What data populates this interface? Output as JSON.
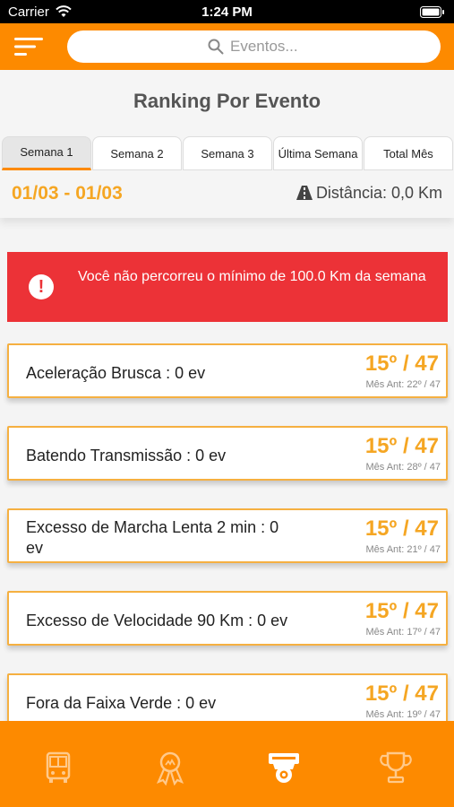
{
  "status_bar": {
    "carrier": "Carrier",
    "time": "1:24 PM",
    "wifi_icon": "wifi-icon",
    "battery_icon": "battery-icon"
  },
  "header": {
    "menu_icon": "hamburger-menu-icon",
    "search": {
      "placeholder": "Eventos...",
      "value": ""
    },
    "accent_color": "#fd8a00"
  },
  "page": {
    "title": "Ranking Por Evento",
    "tabs": [
      {
        "label": "Semana 1",
        "active": true
      },
      {
        "label": "Semana 2",
        "active": false
      },
      {
        "label": "Semana 3",
        "active": false
      },
      {
        "label": "Última Semana",
        "active": false
      },
      {
        "label": "Total Mês",
        "active": false
      }
    ],
    "date_range": "01/03 - 01/03",
    "distance": "Distância: 0,0 Km"
  },
  "warning": {
    "message": "Você não percorreu o mínimo de 100.0 Km da semana",
    "color": "#ec3237"
  },
  "events": [
    {
      "label": "Aceleração Brusca : 0 ev",
      "rank": "15º / 47",
      "previous": "Mês Ant: 22º / 47"
    },
    {
      "label": "Batendo Transmissão : 0 ev",
      "rank": "15º / 47",
      "previous": "Mês Ant: 28º / 47"
    },
    {
      "label": "Excesso de Marcha Lenta 2 min : 0 ev",
      "rank": "15º / 47",
      "previous": "Mês Ant: 21º / 47"
    },
    {
      "label": "Excesso de Velocidade 90 Km : 0 ev",
      "rank": "15º / 47",
      "previous": "Mês Ant: 17º / 47"
    },
    {
      "label": "Fora da Faixa Verde : 0 ev",
      "rank": "15º / 47",
      "previous": "Mês Ant: 19º / 47"
    }
  ],
  "bottom_nav": [
    {
      "icon": "bus-icon",
      "active": false
    },
    {
      "icon": "award-ribbon-icon",
      "active": false
    },
    {
      "icon": "speed-camera-icon",
      "active": true
    },
    {
      "icon": "trophy-icon",
      "active": false
    }
  ]
}
